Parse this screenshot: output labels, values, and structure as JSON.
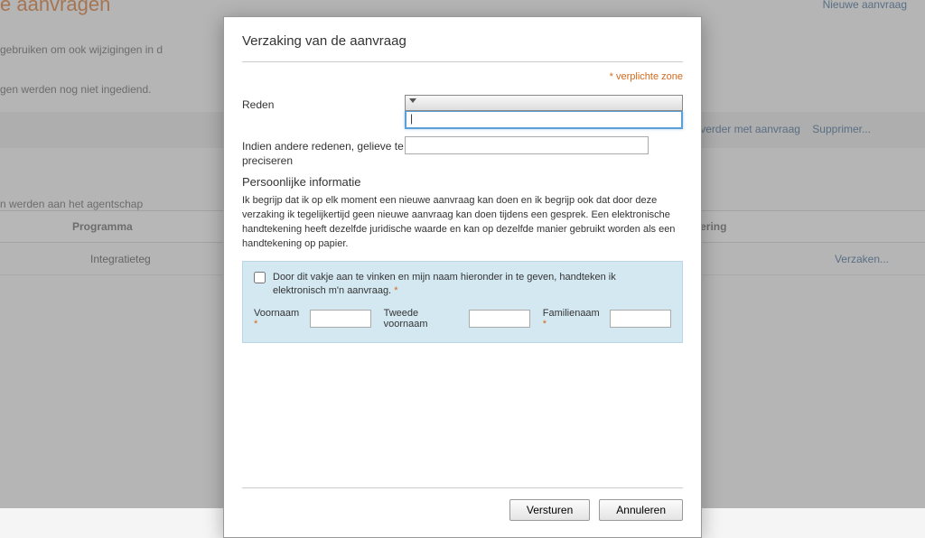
{
  "background": {
    "page_title": "e aanvragen",
    "new_request_link": "Nieuwe aanvraag",
    "text1": "gebruiken om ook wijzigingen in d",
    "text2": "gen werden nog niet ingediend.",
    "row_actions": {
      "cont": "n verder met aanvraag",
      "del": "Supprimer..."
    },
    "text3": "n werden aan het agentschap",
    "table": {
      "col_programma": "Programma",
      "col_reden": "Reden voor Weigering",
      "row_programma": "Integratieteg",
      "row_action": "Verzaken..."
    }
  },
  "modal": {
    "title": "Verzaking van de aanvraag",
    "required_note": "* verplichte zone",
    "reason_label": "Reden",
    "specify_label": "Indien andere redenen, gelieve te preciseren",
    "section": "Persoonlijke informatie",
    "disclaimer": "Ik begrijp dat ik op elk moment een nieuwe aanvraag kan doen en ik begrijp ook dat door deze verzaking ik tegelijkertijd geen nieuwe aanvraag kan doen tijdens een gesprek. Een elektronische handtekening heeft dezelfde juridische waarde en kan op dezelfde manier gebruikt worden als een handtekening op papier.",
    "sign_text": "Door dit vakje aan te vinken en mijn naam hieronder in te geven, handteken ik elektronisch m'n aanvraag.",
    "firstname_label": "Voornaam",
    "middlename_label": "Tweede voornaam",
    "lastname_label": "Familienaam",
    "submit": "Versturen",
    "cancel": "Annuleren",
    "cursor": "|"
  }
}
